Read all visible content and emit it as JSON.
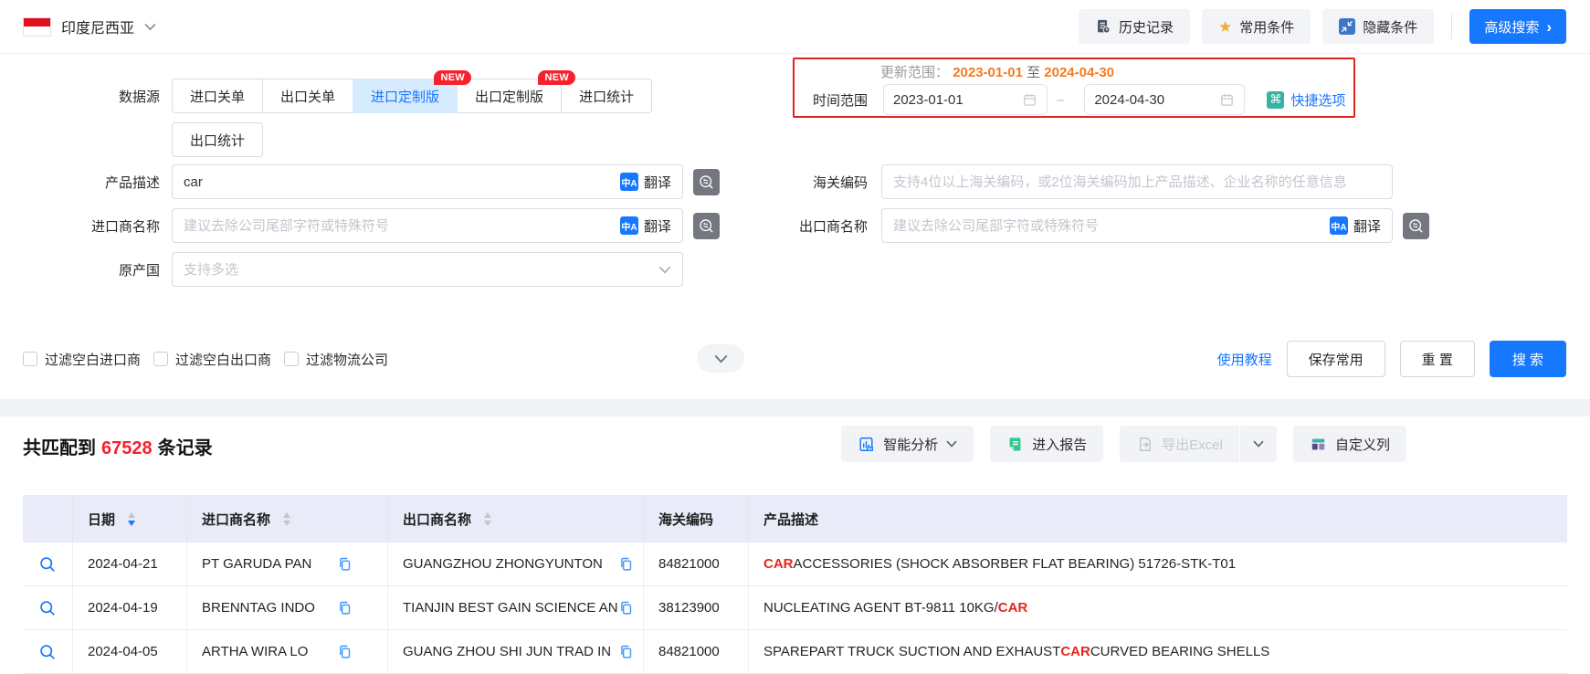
{
  "topbar": {
    "country": "印度尼西亚",
    "history": "历史记录",
    "favorites": "常用条件",
    "hide": "隐藏条件",
    "advanced": "高级搜索",
    "advanced_arrow": "›"
  },
  "form": {
    "datasource_label": "数据源",
    "tabs_row1": [
      {
        "label": "进口关单",
        "active": false,
        "badge": ""
      },
      {
        "label": "出口关单",
        "active": false,
        "badge": ""
      },
      {
        "label": "进口定制版",
        "active": true,
        "badge": "NEW"
      },
      {
        "label": "出口定制版",
        "active": false,
        "badge": "NEW"
      },
      {
        "label": "进口统计",
        "active": false,
        "badge": ""
      }
    ],
    "tabs_row2": [
      {
        "label": "出口统计",
        "active": false,
        "badge": ""
      }
    ],
    "update_range": {
      "label": "更新范围：",
      "start": "2023-01-01",
      "conj": "至",
      "end": "2024-04-30"
    },
    "time_range": {
      "label": "时间范围",
      "start_value": "2023-01-01",
      "dash": "–",
      "end_value": "2024-04-30",
      "quick": "快捷选项"
    },
    "product": {
      "label": "产品描述",
      "value": "car",
      "translate": "翻译"
    },
    "importer": {
      "label": "进口商名称",
      "placeholder": "建议去除公司尾部字符或特殊符号",
      "translate": "翻译"
    },
    "origin": {
      "label": "原产国",
      "placeholder": "支持多选"
    },
    "hs": {
      "label": "海关编码",
      "placeholder": "支持4位以上海关编码，或2位海关编码加上产品描述、企业名称的任意信息"
    },
    "exporter": {
      "label": "出口商名称",
      "placeholder": "建议去除公司尾部字符或特殊符号",
      "translate": "翻译"
    },
    "filters": [
      "过滤空白进口商",
      "过滤空白出口商",
      "过滤物流公司"
    ],
    "actions": {
      "tutorial": "使用教程",
      "save": "保存常用",
      "reset": "重 置",
      "search": "搜 索"
    }
  },
  "results": {
    "count_prefix": "共匹配到",
    "count": "67528",
    "count_suffix": "条记录",
    "toolbar": {
      "analysis": "智能分析",
      "report": "进入报告",
      "export": "导出Excel",
      "custom": "自定义列"
    }
  },
  "table": {
    "columns": [
      {
        "label": "",
        "sortable": false,
        "sort": ""
      },
      {
        "label": "日期",
        "sortable": true,
        "sort": "desc"
      },
      {
        "label": "进口商名称",
        "sortable": true,
        "sort": ""
      },
      {
        "label": "出口商名称",
        "sortable": true,
        "sort": ""
      },
      {
        "label": "海关编码",
        "sortable": false,
        "sort": ""
      },
      {
        "label": "产品描述",
        "sortable": false,
        "sort": ""
      }
    ],
    "rows": [
      {
        "date": "2024-04-21",
        "importer": "PT GARUDA PAN",
        "exporter": "GUANGZHOU ZHONGYUNTON",
        "hs": "84821000",
        "product": [
          {
            "t": "CAR",
            "hl": true
          },
          {
            "t": " ACCESSORIES (SHOCK ABSORBER FLAT BEARING) 51726-STK-T01",
            "hl": false
          }
        ]
      },
      {
        "date": "2024-04-19",
        "importer": "BRENNTAG INDO",
        "exporter": "TIANJIN BEST GAIN SCIENCE AN",
        "hs": "38123900",
        "product": [
          {
            "t": "NUCLEATING AGENT BT-9811 10KG/",
            "hl": false
          },
          {
            "t": "CAR",
            "hl": true
          }
        ]
      },
      {
        "date": "2024-04-05",
        "importer": "ARTHA WIRA LO",
        "exporter": "GUANG ZHOU SHI JUN TRAD IN",
        "hs": "84821000",
        "product": [
          {
            "t": "SPAREPART TRUCK SUCTION AND EXHAUST ",
            "hl": false
          },
          {
            "t": "CAR",
            "hl": true
          },
          {
            "t": " CURVED BEARING SHELLS",
            "hl": false
          }
        ]
      }
    ]
  },
  "colors": {
    "accent": "#1677ff",
    "danger": "#f5222d",
    "highlight": "#e8261d",
    "orange": "#f57a20",
    "alert_border": "#e0231c",
    "teal": "#38b2a3",
    "badge": "#f5222d"
  }
}
